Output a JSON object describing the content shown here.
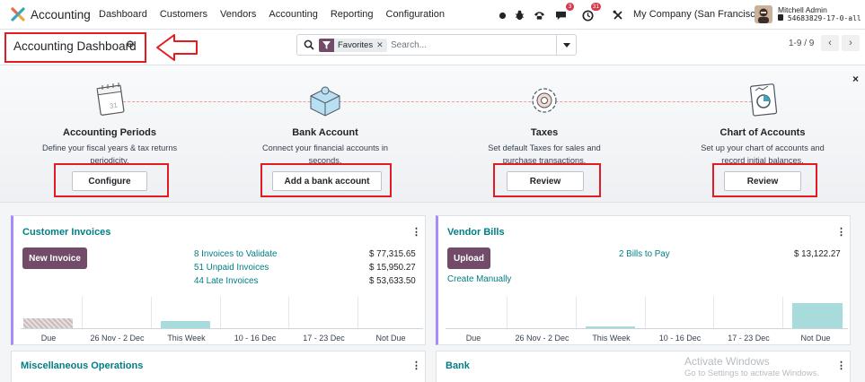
{
  "topnav": {
    "app_name": "Accounting",
    "menu": [
      "Dashboard",
      "Customers",
      "Vendors",
      "Accounting",
      "Reporting",
      "Configuration"
    ],
    "messages_badge": "3",
    "activities_badge": "31",
    "company": "My Company (San Francisco)",
    "user_name": "Mitchell Admin",
    "db_name": "54683829-17-0-all"
  },
  "control": {
    "title": "Accounting Dashboard",
    "facet_label": "Favorites",
    "search_placeholder": "Search...",
    "pager": "1-9 / 9",
    "prev": "‹",
    "next": "›"
  },
  "onboarding": {
    "close": "×",
    "steps": [
      {
        "title": "Accounting Periods",
        "desc": "Define your fiscal years & tax returns periodicity.",
        "button": "Configure"
      },
      {
        "title": "Bank Account",
        "desc": "Connect your financial accounts in seconds.",
        "button": "Add a bank account"
      },
      {
        "title": "Taxes",
        "desc": "Set default Taxes for sales and purchase transactions.",
        "button": "Review"
      },
      {
        "title": "Chart of Accounts",
        "desc": "Set up your chart of accounts and record initial balances.",
        "button": "Review"
      }
    ]
  },
  "cards": {
    "customer_invoices": {
      "title": "Customer Invoices",
      "button": "New Invoice",
      "rows": [
        {
          "label": "8 Invoices to Validate",
          "amount": "$ 77,315.65"
        },
        {
          "label": "51 Unpaid Invoices",
          "amount": "$ 15,950.27"
        },
        {
          "label": "44 Late Invoices",
          "amount": "$ 53,633.50"
        }
      ],
      "chart_labels": [
        "Due",
        "26 Nov - 2 Dec",
        "This Week",
        "10 - 16 Dec",
        "17 - 23 Dec",
        "Not Due"
      ]
    },
    "vendor_bills": {
      "title": "Vendor Bills",
      "button": "Upload",
      "secondary_link": "Create Manually",
      "rows": [
        {
          "label": "2 Bills to Pay",
          "amount": "$ 13,122.27"
        }
      ],
      "chart_labels": [
        "Due",
        "26 Nov - 2 Dec",
        "This Week",
        "10 - 16 Dec",
        "17 - 23 Dec",
        "Not Due"
      ]
    },
    "misc": {
      "title": "Miscellaneous Operations"
    },
    "bank": {
      "title": "Bank"
    },
    "kebab": "⋮"
  },
  "watermark": {
    "line1": "Activate Windows",
    "line2": "Go to Settings to activate Windows."
  },
  "colors": {
    "brand": "#714b67",
    "link": "#017e84",
    "highlight": "#e31b23",
    "card_accent": "#a78bfa",
    "bar_fill": "#a8dcdc"
  }
}
